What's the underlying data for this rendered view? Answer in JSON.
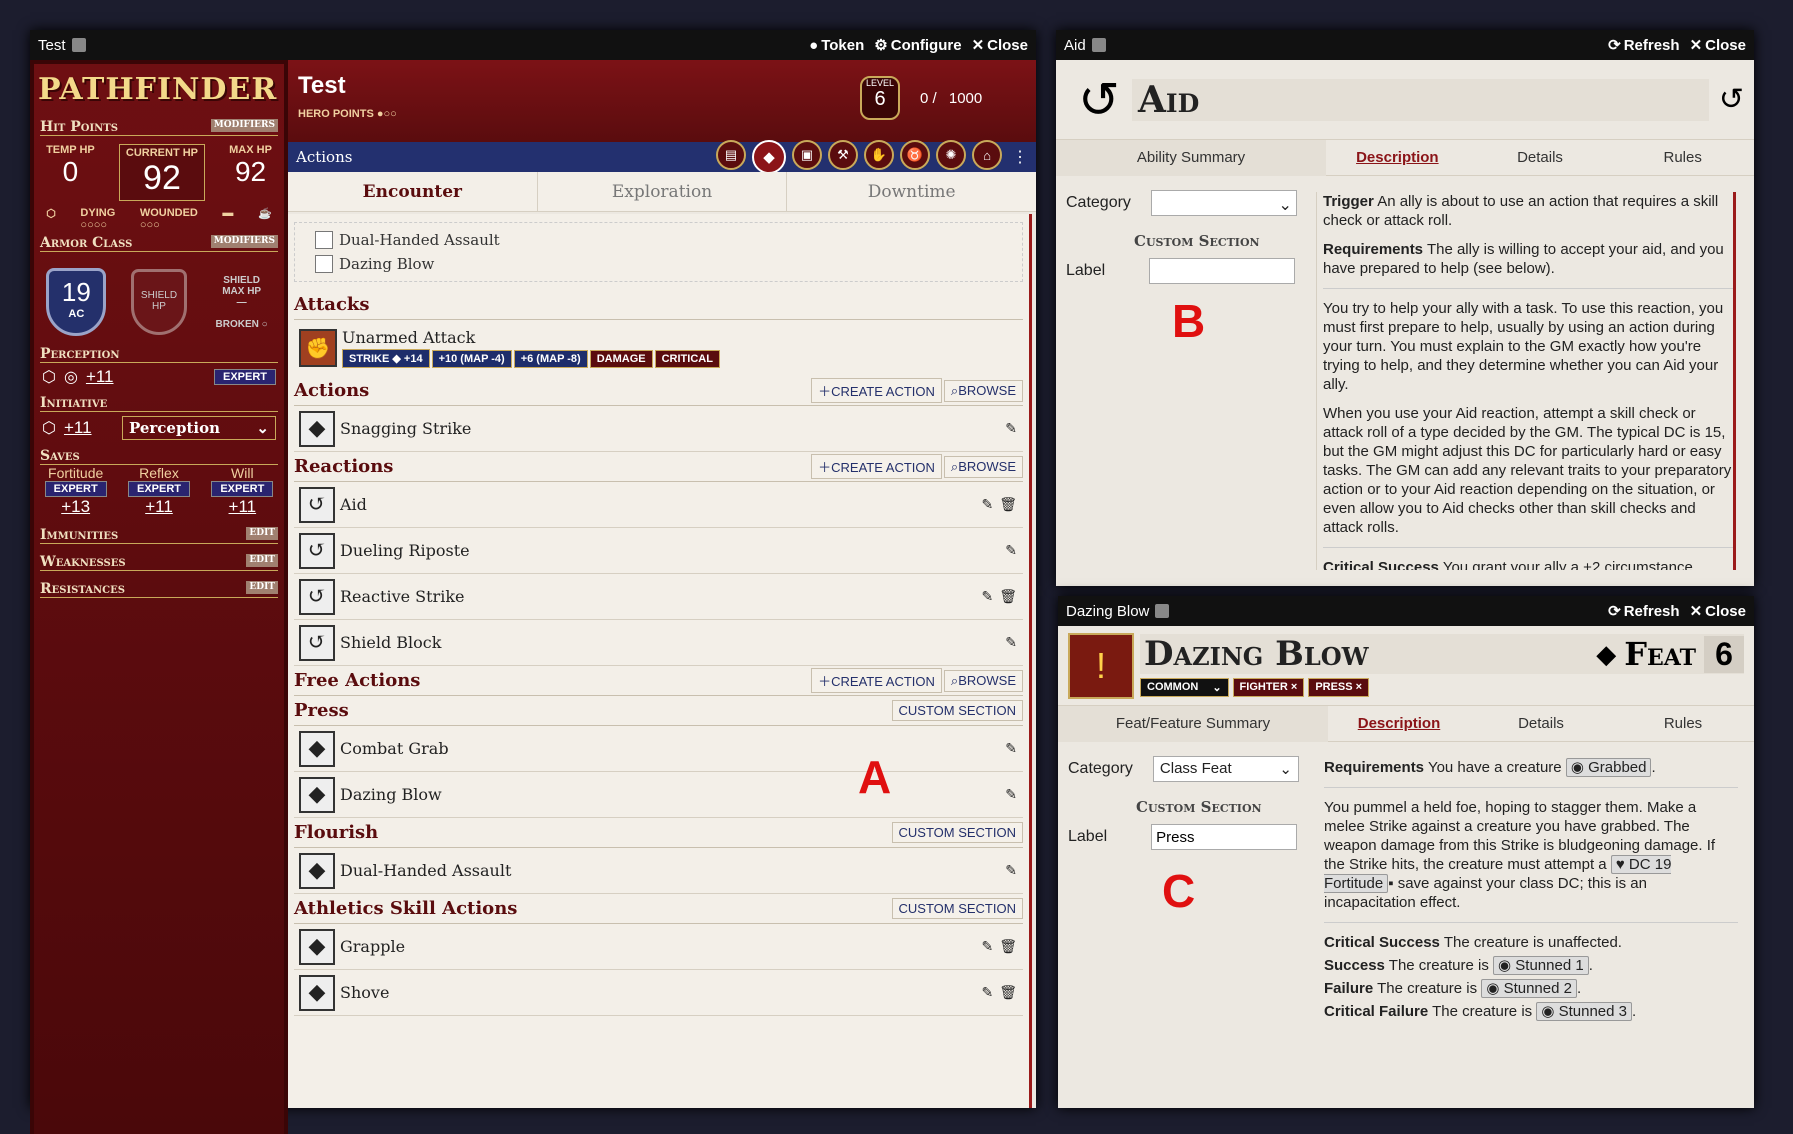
{
  "sheet": {
    "window_title": "Test",
    "controls": {
      "token": "Token",
      "configure": "Configure",
      "close": "Close"
    },
    "logo": "PATHFINDER",
    "name": "Test",
    "hero_points": "HERO POINTS",
    "level_label": "LEVEL",
    "level": "6",
    "xp": "0 /",
    "xp_max": "1000",
    "hit_points_label": "Hit Points",
    "modifiers": "MODIFIERS",
    "temp_hp_label": "TEMP HP",
    "temp_hp": "0",
    "current_hp_label": "CURRENT HP",
    "current_hp": "92",
    "max_hp_label": "MAX HP",
    "max_hp": "92",
    "dying": "DYING",
    "wounded": "WOUNDED",
    "armor_class_label": "Armor Class",
    "ac": "19",
    "ac_label": "AC",
    "shield_hp": "SHIELD HP",
    "shield_max_hp": "SHIELD MAX HP",
    "shield_dash": "—",
    "broken": "BROKEN",
    "perception_label": "Perception",
    "perception": "+11",
    "perception_rank": "EXPERT",
    "initiative_label": "Initiative",
    "initiative": "+11",
    "initiative_select": "Perception",
    "saves_label": "Saves",
    "saves": [
      {
        "name": "Fortitude",
        "rank": "EXPERT",
        "value": "+13"
      },
      {
        "name": "Reflex",
        "rank": "EXPERT",
        "value": "+11"
      },
      {
        "name": "Will",
        "rank": "EXPERT",
        "value": "+11"
      }
    ],
    "immunities": "Immunities",
    "weaknesses": "Weaknesses",
    "resistances": "Resistances",
    "edit": "EDIT",
    "tab_bar_title": "Actions",
    "subtabs": [
      "Encounter",
      "Exploration",
      "Downtime"
    ],
    "toggles": [
      "Dual-Handed Assault",
      "Dazing Blow"
    ],
    "attacks_label": "Attacks",
    "attack_name": "Unarmed Attack",
    "attack_tags": [
      "STRIKE ◆ +14",
      "+10 (MAP -4)",
      "+6 (MAP -8)",
      "DAMAGE",
      "CRITICAL"
    ],
    "create_action": "CREATE ACTION",
    "browse": "BROWSE",
    "custom_section": "CUSTOM SECTION",
    "actions_label": "Actions",
    "actions": [
      "Snagging Strike"
    ],
    "reactions_label": "Reactions",
    "reactions": [
      "Aid",
      "Dueling Riposte",
      "Reactive Strike",
      "Shield Block"
    ],
    "free_label": "Free Actions",
    "press_label": "Press",
    "press": [
      "Combat Grab",
      "Dazing Blow"
    ],
    "flourish_label": "Flourish",
    "flourish": [
      "Dual-Handed Assault"
    ],
    "athletics_label": "Athletics Skill Actions",
    "athletics": [
      "Grapple",
      "Shove"
    ]
  },
  "aid": {
    "window_title": "Aid",
    "refresh": "Refresh",
    "close": "Close",
    "title": "Aid",
    "tabs": [
      "Ability Summary",
      "Description",
      "Details",
      "Rules"
    ],
    "category_label": "Category",
    "custom_section": "Custom Section",
    "label_label": "Label",
    "trigger_label": "Trigger",
    "trigger": "An ally is about to use an action that requires a skill check or attack roll.",
    "req_label": "Requirements",
    "req": "The ally is willing to accept your aid, and you have prepared to help (see below).",
    "p1": "You try to help your ally with a task. To use this reaction, you must first prepare to help, usually by using an action during your turn. You must explain to the GM exactly how you're trying to help, and they determine whether you can Aid your ally.",
    "p2": "When you use your Aid reaction, attempt a skill check or attack roll of a type decided by the GM. The typical DC is 15, but the GM might adjust this DC for particularly hard or easy tasks. The GM can add any relevant traits to your preparatory action or to your Aid reaction depending on the situation, or even allow you to Aid checks other than skill checks and attack rolls.",
    "crit_label": "Critical Success",
    "crit": "You grant your ally a +2 circumstance"
  },
  "feat": {
    "window_title": "Dazing Blow",
    "refresh": "Refresh",
    "close": "Close",
    "title": "Dazing Blow",
    "type": "Feat",
    "level": "6",
    "rarity": "COMMON",
    "traits": [
      "FIGHTER ×",
      "PRESS ×"
    ],
    "tabs": [
      "Feat/Feature Summary",
      "Description",
      "Details",
      "Rules"
    ],
    "category_label": "Category",
    "category_value": "Class Feat",
    "custom_section": "Custom Section",
    "label_label": "Label",
    "label_value": "Press",
    "req_label": "Requirements",
    "req": "You have a creature",
    "grabbed": "Grabbed",
    "p1": "You pummel a held foe, hoping to stagger them. Make a melee Strike against a creature you have grabbed. The weapon damage from this Strike is bludgeoning damage. If the Strike hits, the creature must attempt a",
    "dc": "DC 19 Fortitude",
    "p1b": "save against your class DC; this is an incapacitation effect.",
    "cs_label": "Critical Success",
    "cs": "The creature is unaffected.",
    "s_label": "Success",
    "s": "The creature is",
    "s_v": "Stunned 1",
    "f_label": "Failure",
    "f": "The creature is",
    "f_v": "Stunned 2",
    "cf_label": "Critical Failure",
    "cf": "The creature is",
    "cf_v": "Stunned 3"
  },
  "annotations": {
    "a": "A",
    "b": "B",
    "c": "C"
  }
}
